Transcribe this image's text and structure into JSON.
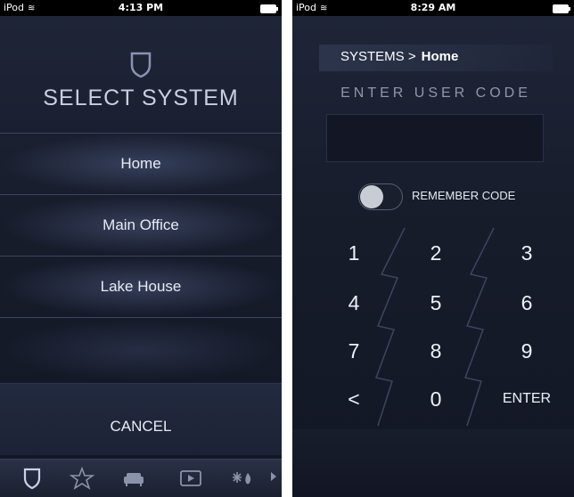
{
  "left": {
    "status": {
      "carrier": "iPod",
      "time": "4:13 PM"
    },
    "title": "SELECT SYSTEM",
    "systems": [
      "Home",
      "Main Office",
      "Lake House"
    ],
    "cancel_label": "CANCEL",
    "tabs": [
      {
        "name": "security",
        "icon": "shield-icon"
      },
      {
        "name": "favorites",
        "icon": "star-icon"
      },
      {
        "name": "room",
        "icon": "sofa-icon"
      },
      {
        "name": "media",
        "icon": "play-icon"
      },
      {
        "name": "climate",
        "icon": "climate-icon"
      }
    ]
  },
  "right": {
    "status": {
      "carrier": "iPod",
      "time": "8:29 AM"
    },
    "breadcrumb": {
      "parent": "SYSTEMS >",
      "current": "Home"
    },
    "enter_label": "ENTER USER CODE",
    "remember_label": "REMEMBER CODE",
    "remember_on": false,
    "keys": [
      "1",
      "2",
      "3",
      "4",
      "5",
      "6",
      "7",
      "8",
      "9",
      "<",
      "0",
      "ENTER"
    ]
  },
  "colors": {
    "background": "#1b2031",
    "divider": "#3b4563",
    "text": "#e8ebf3",
    "muted": "#8f97ad"
  }
}
